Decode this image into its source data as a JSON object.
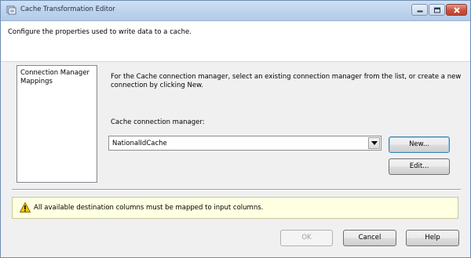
{
  "window": {
    "title": "Cache Transformation Editor",
    "icon": "cache-transformation-icon",
    "controls": {
      "minimize_icon": "minimize-icon",
      "maximize_icon": "maximize-icon",
      "close_icon": "close-icon"
    }
  },
  "header": {
    "description": "Configure the properties used to write data to a cache."
  },
  "nav": {
    "items": [
      {
        "label": "Connection Manager"
      },
      {
        "label": "Mappings"
      }
    ]
  },
  "main": {
    "instructions": "For the Cache connection manager, select an existing connection manager from the list, or create a new connection by clicking New.",
    "field_label": "Cache connection manager:",
    "connection_value": "NationalIdCache",
    "new_label": "New...",
    "edit_label": "Edit..."
  },
  "warning": {
    "icon": "warning-icon",
    "text": "All available destination columns must be mapped to input columns."
  },
  "footer": {
    "ok_label": "OK",
    "cancel_label": "Cancel",
    "help_label": "Help"
  },
  "colors": {
    "titlebar": "#bcd2ec",
    "warning_background": "#ffffe1",
    "close_button": "#c8513c"
  }
}
